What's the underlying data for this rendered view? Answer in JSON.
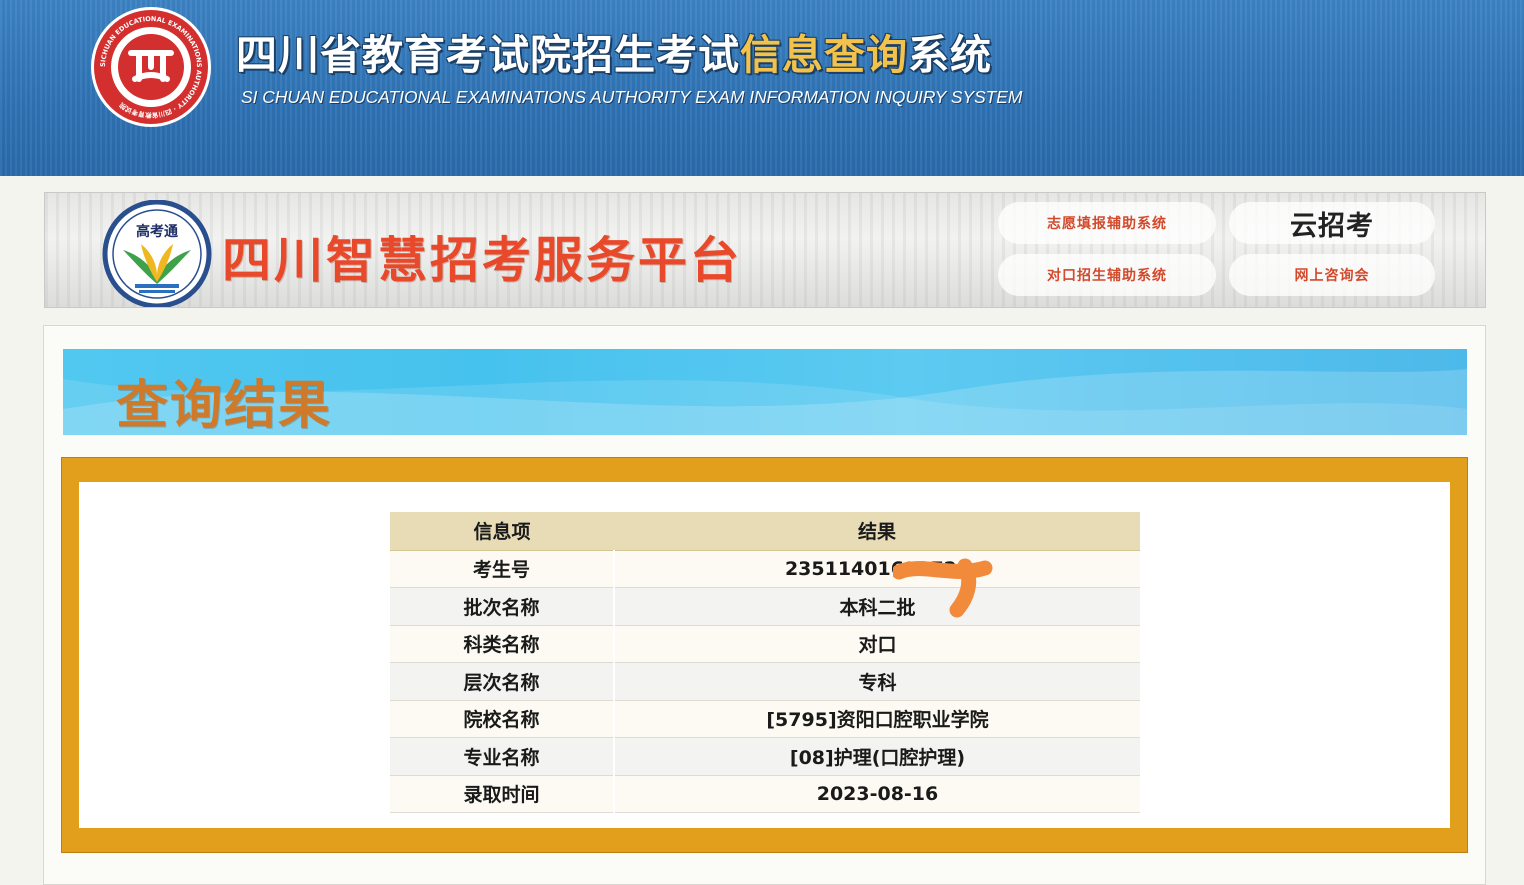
{
  "header": {
    "emblem_text": "SICHUAN EDUCATIONAL EXAMINATIONS AUTHORITY · 四川省教育考试院",
    "title_main": "四川省教育考试院招生考试",
    "title_highlight": "信息查询",
    "title_end": "系统",
    "subtitle": "SI CHUAN EDUCATIONAL EXAMINATIONS AUTHORITY EXAM INFORMATION INQUIRY SYSTEM"
  },
  "banner": {
    "logo_text": "高考通",
    "title": "四川智慧招考服务平台",
    "buttons": {
      "volunteer": "志愿填报辅助系统",
      "yun": "云招考",
      "vocational": "对口招生辅助系统",
      "consult": "网上咨询会"
    }
  },
  "result": {
    "title": "查询结果",
    "table": {
      "headers": [
        "信息项",
        "结果"
      ],
      "rows": [
        {
          "key": "考生号",
          "value": "23511401613726"
        },
        {
          "key": "批次名称",
          "value": "本科二批"
        },
        {
          "key": "科类名称",
          "value": "对口"
        },
        {
          "key": "层次名称",
          "value": "专科"
        },
        {
          "key": "院校名称",
          "value": "[5795]资阳口腔职业学院"
        },
        {
          "key": "专业名称",
          "value": "[08]护理(口腔护理)"
        },
        {
          "key": "录取时间",
          "value": "2023-08-16"
        }
      ]
    }
  },
  "colors": {
    "header_blue": "#2f73b5",
    "title_highlight": "#f2c24b",
    "banner_red": "#e8492a",
    "result_title_orange": "#cf7a2a",
    "frame_gold": "#e29f1c",
    "table_header": "#e8dcb6",
    "scribble_orange": "#f28a3c"
  }
}
